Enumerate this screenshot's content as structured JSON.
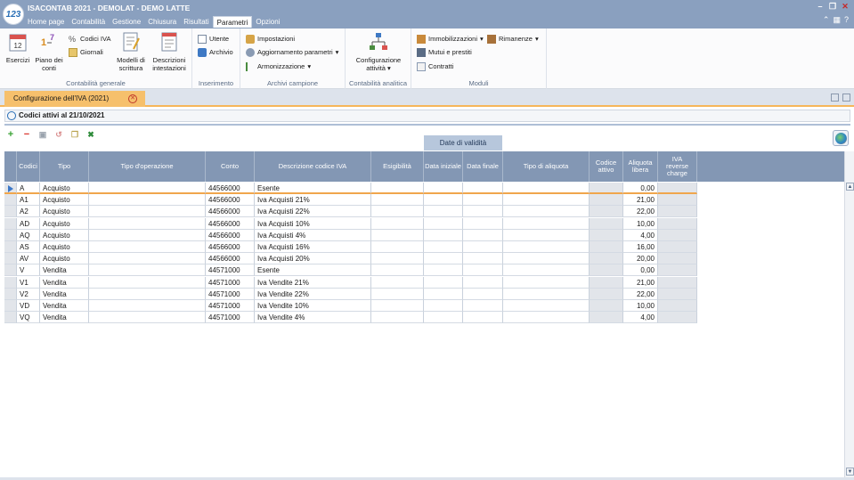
{
  "app": {
    "title": "ISACONTAB 2021 - DEMOLAT - DEMO LATTE",
    "logo": "123"
  },
  "menu": [
    "Home page",
    "Contabilità",
    "Gestione",
    "Chiusura",
    "Risultati",
    "Parametri",
    "Opzioni"
  ],
  "active_menu": "Parametri",
  "ribbon": {
    "contabilita_generale": {
      "label": "Contabilità generale",
      "esercizi": "Esercizi",
      "piano_dei_conti": "Piano dei conti",
      "codici_iva": "Codici IVA",
      "giornali": "Giornali",
      "modelli_di_scrittura": "Modelli di scrittura",
      "descrizioni_intestazioni": "Descrizioni intestazioni"
    },
    "inserimento": {
      "label": "Inserimento",
      "utente": "Utente",
      "archivio": "Archivio"
    },
    "archivi_campione": {
      "label": "Archivi campione",
      "impostazioni": "Impostazioni",
      "aggiornamento_parametri": "Aggiornamento parametri",
      "armonizzazione": "Armonizzazione"
    },
    "contabilita_analitica": {
      "label": "Contabilità analitica",
      "configurazione_attivita": "Configurazione attività"
    },
    "moduli": {
      "label": "Moduli",
      "immobilizzazioni": "Immobilizzazioni",
      "rimanenze": "Rimanenze",
      "mutui_e_prestiti": "Mutui e prestiti",
      "contratti": "Contratti"
    }
  },
  "document_tab": "Configurazione dell'IVA (2021)",
  "section_title": "Codici attivi al 21/10/2021",
  "band_header": "Date di validità",
  "columns": [
    "Codici",
    "Tipo",
    "Tipo d'operazione",
    "Conto",
    "Descrizione codice IVA",
    "Esigibilità",
    "Data iniziale",
    "Data finale",
    "Tipo di aliquota",
    "Codice attivo",
    "Aliquota libera",
    "IVA reverse charge"
  ],
  "rows": [
    {
      "codice": "A",
      "tipo": "Acquisto",
      "conto": "44566000",
      "descrizione": "Esente",
      "aliquota": "0,00"
    },
    {
      "codice": "A1",
      "tipo": "Acquisto",
      "conto": "44566000",
      "descrizione": "Iva Acquisti 21%",
      "aliquota": "21,00"
    },
    {
      "codice": "A2",
      "tipo": "Acquisto",
      "conto": "44566000",
      "descrizione": "Iva Acquisti 22%",
      "aliquota": "22,00"
    },
    {
      "codice": "AD",
      "tipo": "Acquisto",
      "conto": "44566000",
      "descrizione": "Iva Acquisti 10%",
      "aliquota": "10,00"
    },
    {
      "codice": "AQ",
      "tipo": "Acquisto",
      "conto": "44566000",
      "descrizione": "Iva Acquisti 4%",
      "aliquota": "4,00"
    },
    {
      "codice": "AS",
      "tipo": "Acquisto",
      "conto": "44566000",
      "descrizione": "Iva Acquisti 16%",
      "aliquota": "16,00"
    },
    {
      "codice": "AV",
      "tipo": "Acquisto",
      "conto": "44566000",
      "descrizione": "Iva Acquisti 20%",
      "aliquota": "20,00"
    },
    {
      "codice": "V",
      "tipo": "Vendita",
      "conto": "44571000",
      "descrizione": "Esente",
      "aliquota": "0,00"
    },
    {
      "codice": "V1",
      "tipo": "Vendita",
      "conto": "44571000",
      "descrizione": "Iva Vendite 21%",
      "aliquota": "21,00"
    },
    {
      "codice": "V2",
      "tipo": "Vendita",
      "conto": "44571000",
      "descrizione": "Iva Vendite 22%",
      "aliquota": "22,00"
    },
    {
      "codice": "VD",
      "tipo": "Vendita",
      "conto": "44571000",
      "descrizione": "Iva Vendite 10%",
      "aliquota": "10,00"
    },
    {
      "codice": "VQ",
      "tipo": "Vendita",
      "conto": "44571000",
      "descrizione": "Iva Vendite 4%",
      "aliquota": "4,00"
    }
  ],
  "colors": {
    "titlebar": "#8aa0bf",
    "header": "#8397b4",
    "tab_accent": "#f6c06c",
    "selected_row_line": "#f0a64c"
  }
}
